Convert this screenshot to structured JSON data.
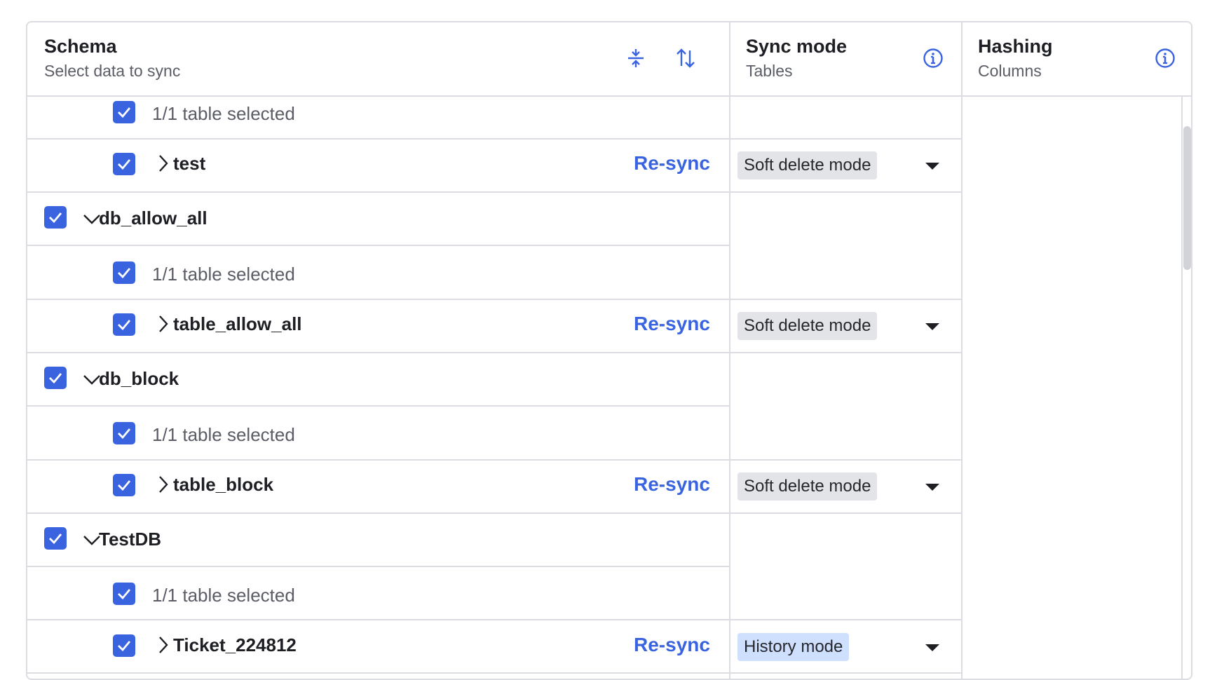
{
  "header": {
    "schema_title": "Schema",
    "schema_sub": "Select data to sync",
    "sync_title": "Sync mode",
    "sync_sub": "Tables",
    "hash_title": "Hashing",
    "hash_sub": "Columns"
  },
  "colors": {
    "accent": "#3a63e0",
    "badge_soft": "#e3e4e8",
    "badge_history": "#cfe0ff",
    "border": "#dcdde2"
  },
  "rows": {
    "r0_sel": "1/1 table selected",
    "r1_table": "test",
    "r1_resync": "Re-sync",
    "r1_mode": "Soft delete mode",
    "r2_schema": "db_allow_all",
    "r3_sel": "1/1 table selected",
    "r4_table": "table_allow_all",
    "r4_resync": "Re-sync",
    "r4_mode": "Soft delete mode",
    "r5_schema": "db_block",
    "r6_sel": "1/1 table selected",
    "r7_table": "table_block",
    "r7_resync": "Re-sync",
    "r7_mode": "Soft delete mode",
    "r8_schema": "TestDB",
    "r9_sel": "1/1 table selected",
    "r10_table": "Ticket_224812",
    "r10_resync": "Re-sync",
    "r10_mode": "History mode"
  }
}
